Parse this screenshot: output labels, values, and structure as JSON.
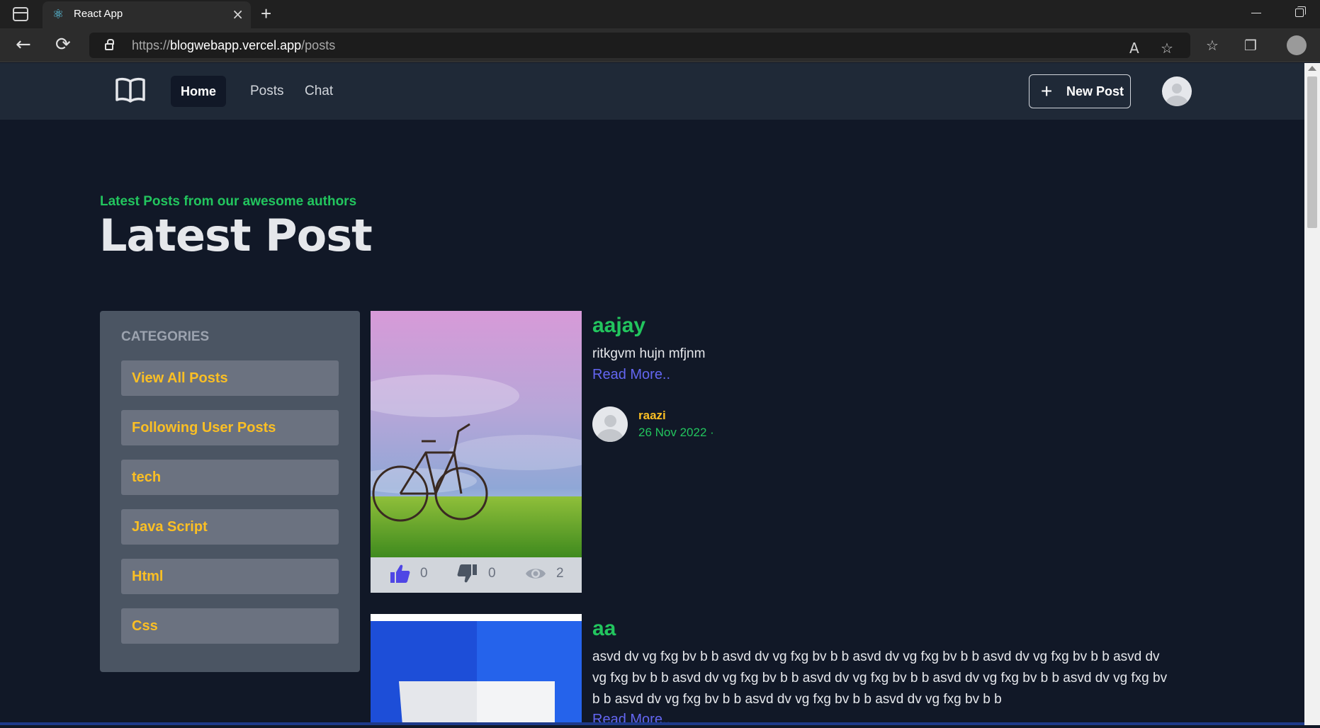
{
  "browser": {
    "tab_title": "React App",
    "url_prefix": "https://",
    "url_host": "blogwebapp.vercel.app",
    "url_path": "/posts"
  },
  "header": {
    "nav": {
      "home": "Home",
      "posts": "Posts",
      "chat": "Chat"
    },
    "new_post_label": "New Post"
  },
  "hero": {
    "eyebrow": "Latest Posts from our awesome authors",
    "title": "Latest Post"
  },
  "categories": {
    "heading": "CATEGORIES",
    "items": [
      "View All Posts",
      "Following User Posts",
      "tech",
      "Java Script",
      "Html",
      "Css"
    ]
  },
  "posts": [
    {
      "title": "aajay",
      "excerpt": "ritkgvm hujn mfjnm",
      "read_more": "Read More..",
      "author": "raazi",
      "date": "26 Nov 2022 ·",
      "likes": "0",
      "dislikes": "0",
      "views": "2"
    },
    {
      "title": "aa",
      "excerpt_lines": [
        "asvd dv vg fxg bv b b asvd dv vg fxg bv b b asvd dv vg fxg bv b b asvd dv vg fxg bv b b asvd dv",
        "vg fxg bv b b asvd dv vg fxg bv b b asvd dv vg fxg bv b b asvd dv vg fxg bv b b asvd dv vg fxg bv",
        "b b asvd dv vg fxg bv b b asvd dv vg fxg bv b b asvd dv vg fxg bv b b"
      ],
      "read_more": "Read More.."
    }
  ],
  "colors": {
    "accent_green": "#22c55e",
    "accent_yellow": "#fbbf24",
    "link_indigo": "#6366f1",
    "background": "#111827"
  },
  "icons": {
    "logo": "book-open-icon",
    "like": "thumbs-up-icon",
    "dislike": "thumbs-down-icon",
    "views": "eye-icon"
  }
}
